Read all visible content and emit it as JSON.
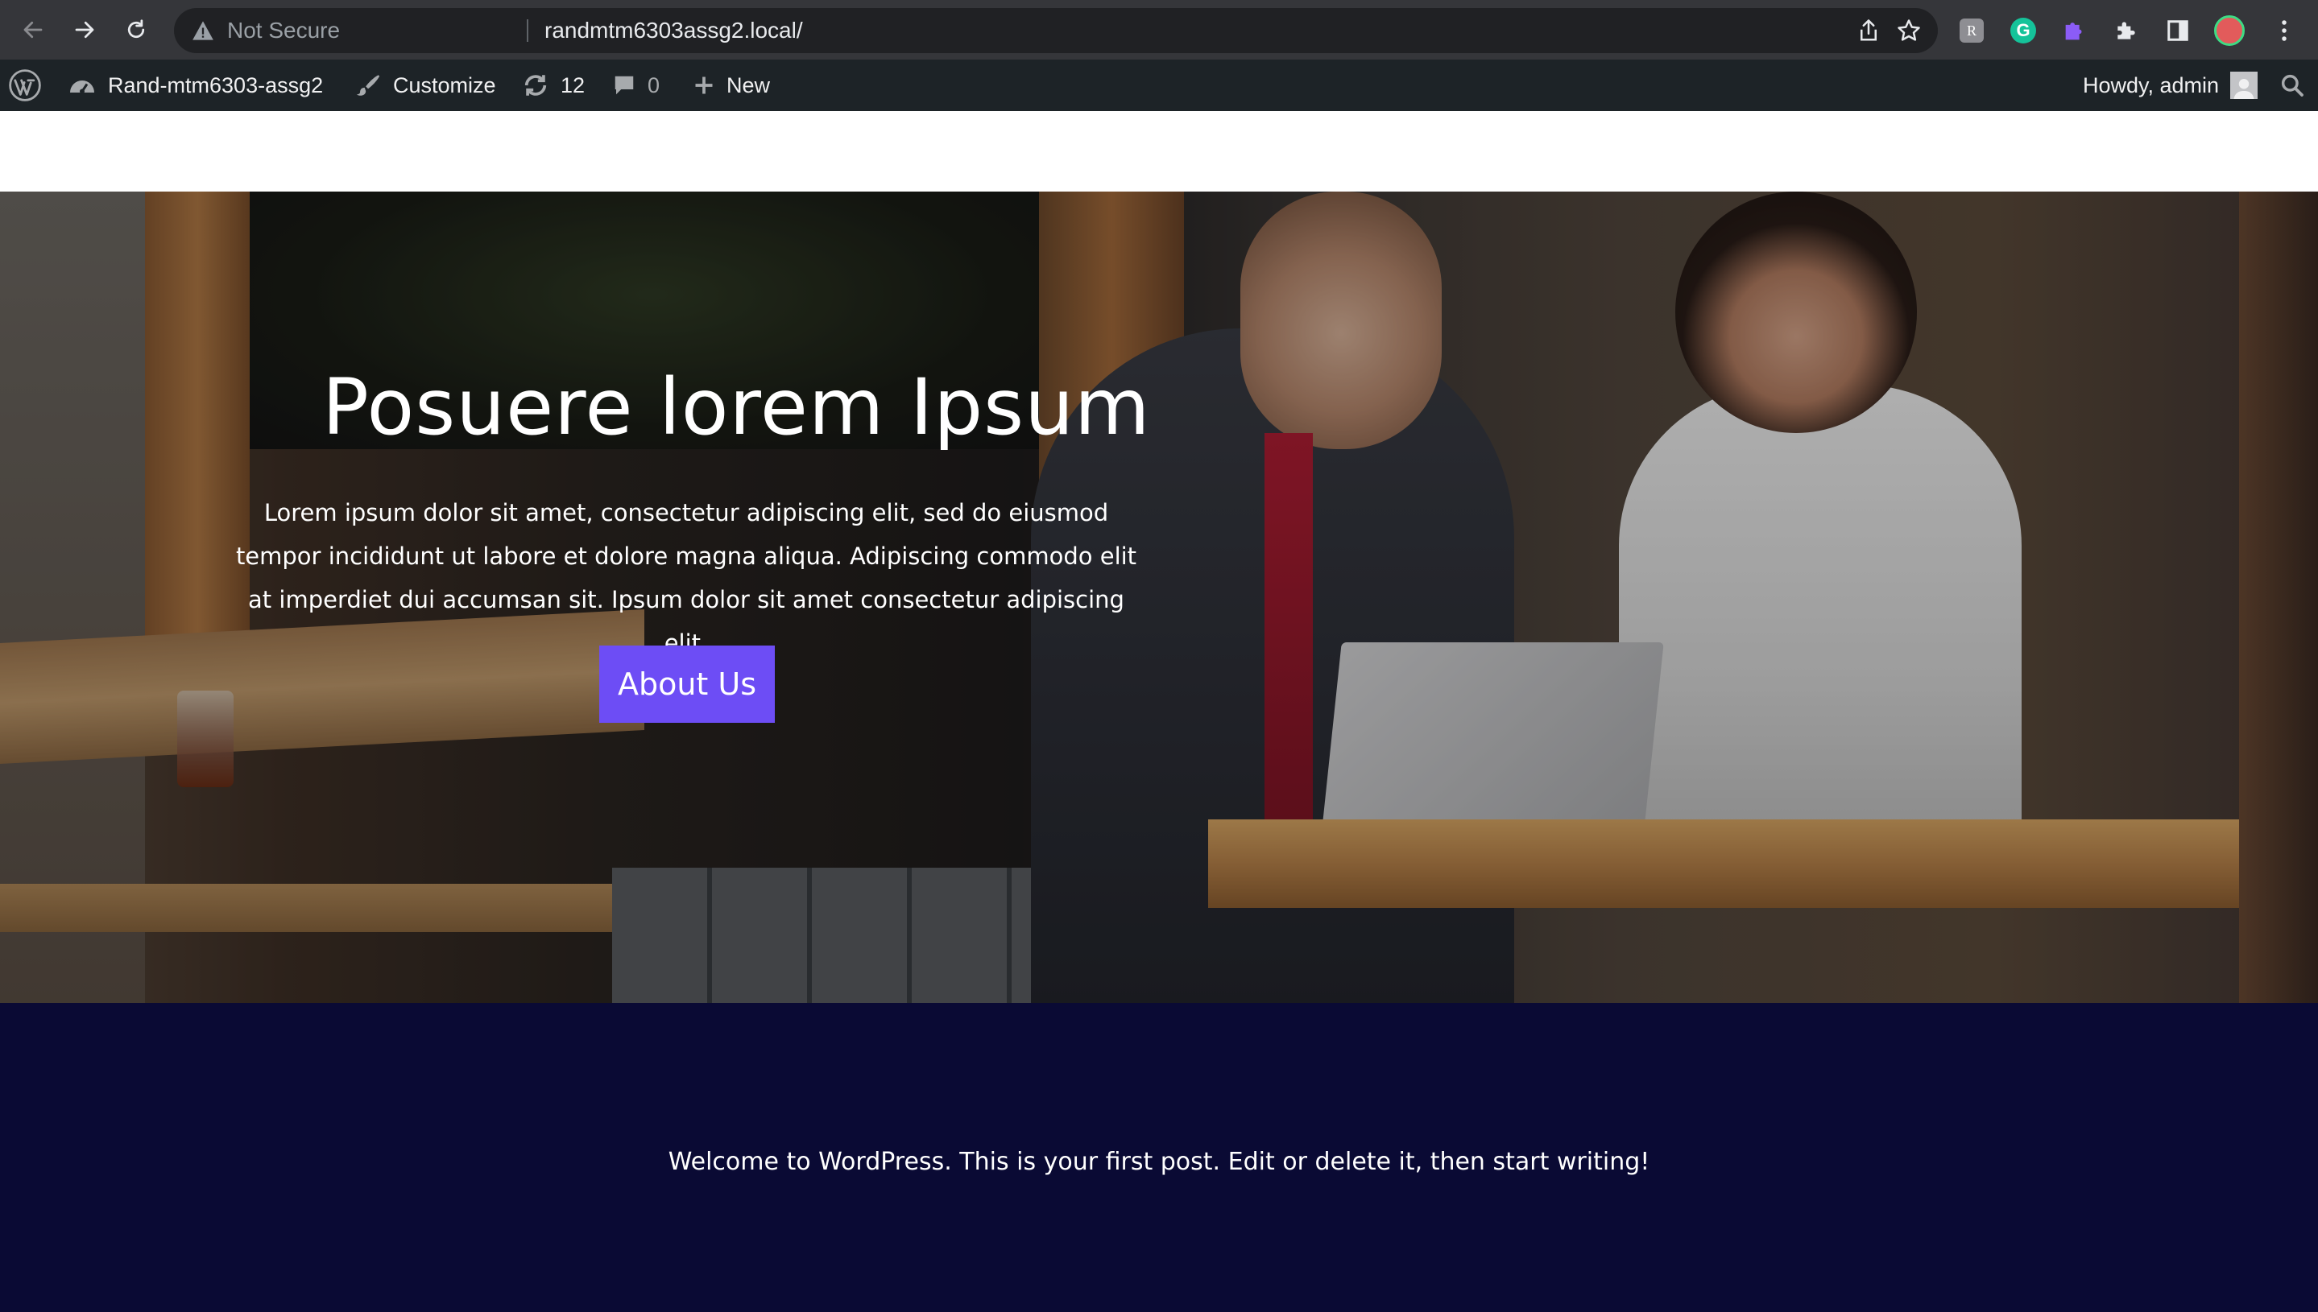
{
  "browser": {
    "security_label": "Not Secure",
    "url": "randmtm6303assg2.local/"
  },
  "admin_bar": {
    "site_name": "Rand-mtm6303-assg2",
    "customize_label": "Customize",
    "updates_count": "12",
    "comments_count": "0",
    "new_label": "New",
    "howdy_label": "Howdy, admin"
  },
  "hero": {
    "title": "Posuere lorem Ipsum",
    "text": "Lorem ipsum dolor sit amet, consectetur adipiscing elit, sed do eiusmod tempor incididunt ut labore et dolore magna aliqua. Adipiscing commodo elit at imperdiet dui accumsan sit. Ipsum dolor sit amet consectetur adipiscing elit.",
    "button_label": "About Us",
    "button_color": "#6d4df5"
  },
  "post": {
    "excerpt": "Welcome to WordPress. This is your first post. Edit or delete it, then start writing!"
  },
  "colors": {
    "admin_bar": "#1d2327",
    "browser_toolbar": "#35363a",
    "footer_bg": "#0a0a34"
  }
}
